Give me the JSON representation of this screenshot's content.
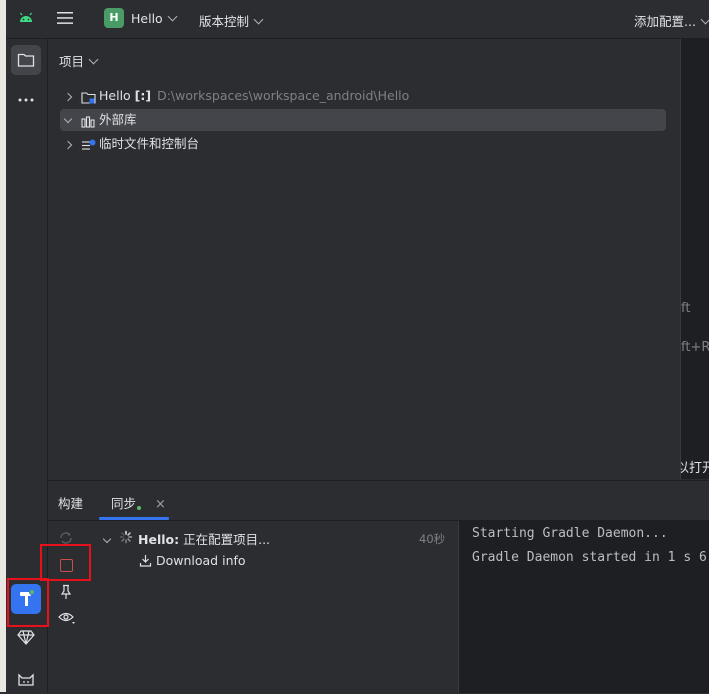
{
  "titlebar": {
    "project_initial": "H",
    "project_name": "Hello",
    "vcs_label": "版本控制",
    "run_config_label": "添加配置..."
  },
  "project_panel": {
    "title": "项目",
    "tree": [
      {
        "label": "Hello",
        "suffix": "[:]",
        "path": "D:\\workspaces\\workspace_android\\Hello",
        "expanded": false,
        "selected": false
      },
      {
        "label": "外部库",
        "expanded": true,
        "selected": true
      },
      {
        "label": "临时文件和控制台",
        "expanded": false,
        "selected": false
      }
    ]
  },
  "right_panel": {
    "frag1": "ft",
    "frag2": "ft+R",
    "frag3": "以打开"
  },
  "build_panel": {
    "tabs": [
      {
        "label": "构建",
        "active": false
      },
      {
        "label": "同步",
        "active": true,
        "close": "×"
      }
    ],
    "task": {
      "name": "Hello:",
      "status": "正在配置项目...",
      "duration": "40秒",
      "child": "Download info"
    },
    "console": [
      "Starting Gradle Daemon...",
      "Gradle Daemon started in 1 s 6"
    ]
  },
  "colors": {
    "accent": "#3574f0",
    "highlight_box": "#e8101a",
    "project_badge": "#4a9c67",
    "stop_icon": "#c94f4f"
  }
}
